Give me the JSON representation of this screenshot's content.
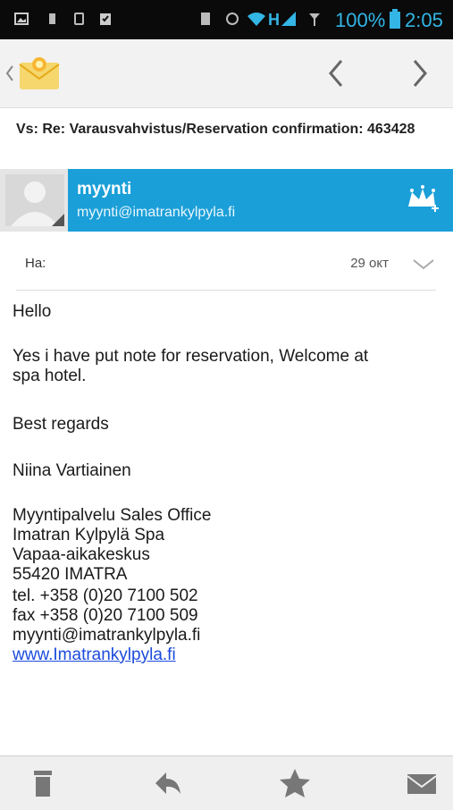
{
  "status_bar": {
    "battery": "100%",
    "time": "2:05",
    "network": "H"
  },
  "action_bar": {
    "icons": [
      "back-chevron-icon",
      "email-app-icon",
      "previous-icon",
      "next-icon"
    ]
  },
  "message": {
    "subject": "Vs: Re: Varausvahvistus/Reservation confirmation: 463428",
    "sender_name": "myynti",
    "sender_email": "myynti@imatrankylpyla.fi",
    "to_label": "Ha:",
    "date": "29 окт",
    "body": {
      "greeting": "Hello",
      "para1_line1": "Yes i have put note for reservation, Welcome at",
      "para1_line2": "spa hotel.",
      "regards": "Best regards",
      "name": "Niina Vartiainen",
      "sig_line1": "Myyntipalvelu Sales Office",
      "sig_line2": "Imatran Kylpylä Spa",
      "sig_line3": "Vapaa-aikakeskus",
      "sig_line4": "55420 IMATRA",
      "sig_line5": "tel. +358 (0)20 7100 502",
      "sig_line6": "fax +358 (0)20 7100 509",
      "sig_line7": "myynti@imatrankylpyla.fi",
      "website": "www.Imatrankylpyla.fi"
    }
  },
  "bottom_bar": {
    "icons": [
      "delete-icon",
      "reply-icon",
      "star-icon",
      "mark-unread-icon"
    ]
  },
  "colors": {
    "accent": "#1a9fd8",
    "status_icon": "#33b5e5",
    "link": "#1b4bdd"
  }
}
